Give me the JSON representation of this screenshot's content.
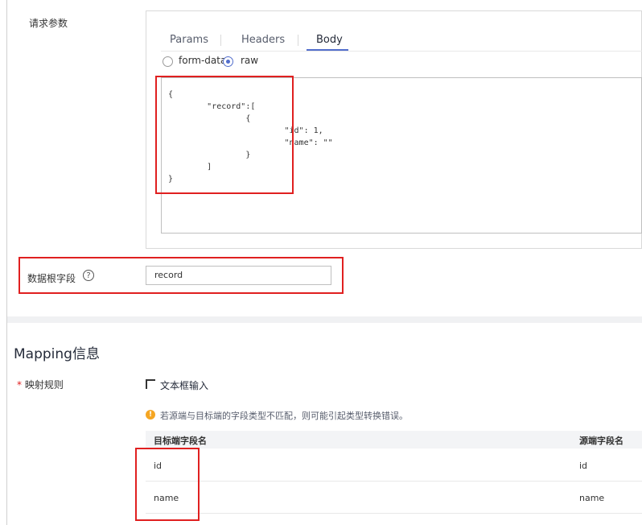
{
  "request_params": {
    "label": "请求参数",
    "tabs": [
      "Params",
      "Headers",
      "Body"
    ],
    "active_tab": "Body",
    "body_type_options": [
      "form-data",
      "raw"
    ],
    "selected_body_type": "raw",
    "body_code": "{\n        \"record\":[\n                {\n                        \"id\": 1,\n                        \"name\": \"\"\n                }\n        ]\n}"
  },
  "data_root_field": {
    "label": "数据根字段",
    "help_icon": "question-circle-icon",
    "value": "record"
  },
  "mapping": {
    "section_title": "Mapping信息",
    "rule_label": "映射规则",
    "required_mark": "*",
    "text_input_label": "文本框输入",
    "text_input_icon": "text-box-icon",
    "warning_icon": "warning-circle-icon",
    "warning_text": "若源端与目标端的字段类型不匹配，则可能引起类型转换错误。",
    "columns": [
      "目标端字段名",
      "源端字段名"
    ],
    "rows": [
      {
        "target": "id",
        "source": "id"
      },
      {
        "target": "name",
        "source": "name"
      }
    ]
  },
  "colors": {
    "accent": "#526ecc",
    "highlight_box": "#e02020",
    "warning": "#f5a623"
  }
}
